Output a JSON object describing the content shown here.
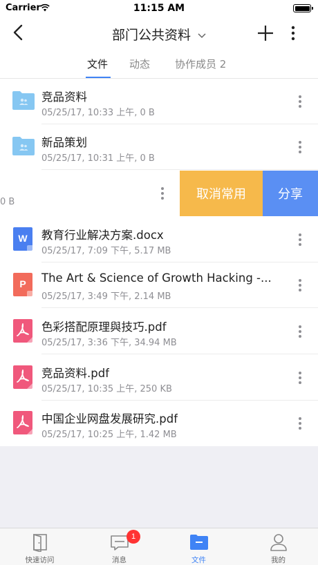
{
  "status_bar": {
    "carrier": "Carrier",
    "time": "11:15 AM"
  },
  "nav": {
    "title": "部门公共资料"
  },
  "tabs": [
    {
      "label": "文件",
      "active": true
    },
    {
      "label": "动态",
      "active": false
    },
    {
      "label": "协作成员 2",
      "active": false
    }
  ],
  "files": [
    {
      "name": "竞品资料",
      "meta": "05/25/17, 10:33 上午, 0 B",
      "type": "folder"
    },
    {
      "name": "新品策划",
      "meta": "05/25/17, 10:31 上午, 0 B",
      "type": "folder"
    },
    {
      "name": "",
      "meta": "0 B",
      "type": "swiped"
    },
    {
      "name": "教育行业解决方案.docx",
      "meta": "05/25/17, 7:09 下午, 5.17 MB",
      "type": "word"
    },
    {
      "name": "The Art & Science of Growth Hacking -...",
      "meta": "05/25/17, 3:49 下午, 2.14 MB",
      "type": "ppt"
    },
    {
      "name": "色彩搭配原理與技巧.pdf",
      "meta": "05/25/17, 3:36 下午, 34.94 MB",
      "type": "pdf"
    },
    {
      "name": "竞品资料.pdf",
      "meta": "05/25/17, 10:35 上午, 250 KB",
      "type": "pdf"
    },
    {
      "name": "中国企业网盘发展研究.pdf",
      "meta": "05/25/17, 10:25 上午, 1.42 MB",
      "type": "pdf"
    }
  ],
  "swipe_actions": {
    "unfavorite": "取消常用",
    "share": "分享"
  },
  "icon_letters": {
    "word": "W",
    "ppt": "P"
  },
  "tabbar": [
    {
      "label": "快速访问",
      "icon": "door-icon",
      "active": false
    },
    {
      "label": "消息",
      "icon": "message-icon",
      "active": false,
      "badge": "1"
    },
    {
      "label": "文件",
      "icon": "folder-icon",
      "active": true
    },
    {
      "label": "我的",
      "icon": "person-icon",
      "active": false
    }
  ],
  "colors": {
    "accent": "#3f83f5",
    "folder": "#86c7f2",
    "word": "#4a7ff0",
    "ppt": "#f26b5b",
    "pdf": "#f0587c",
    "unfavorite_action": "#f6b94b",
    "share_action": "#5a8ff3",
    "badge": "#ff3333"
  }
}
